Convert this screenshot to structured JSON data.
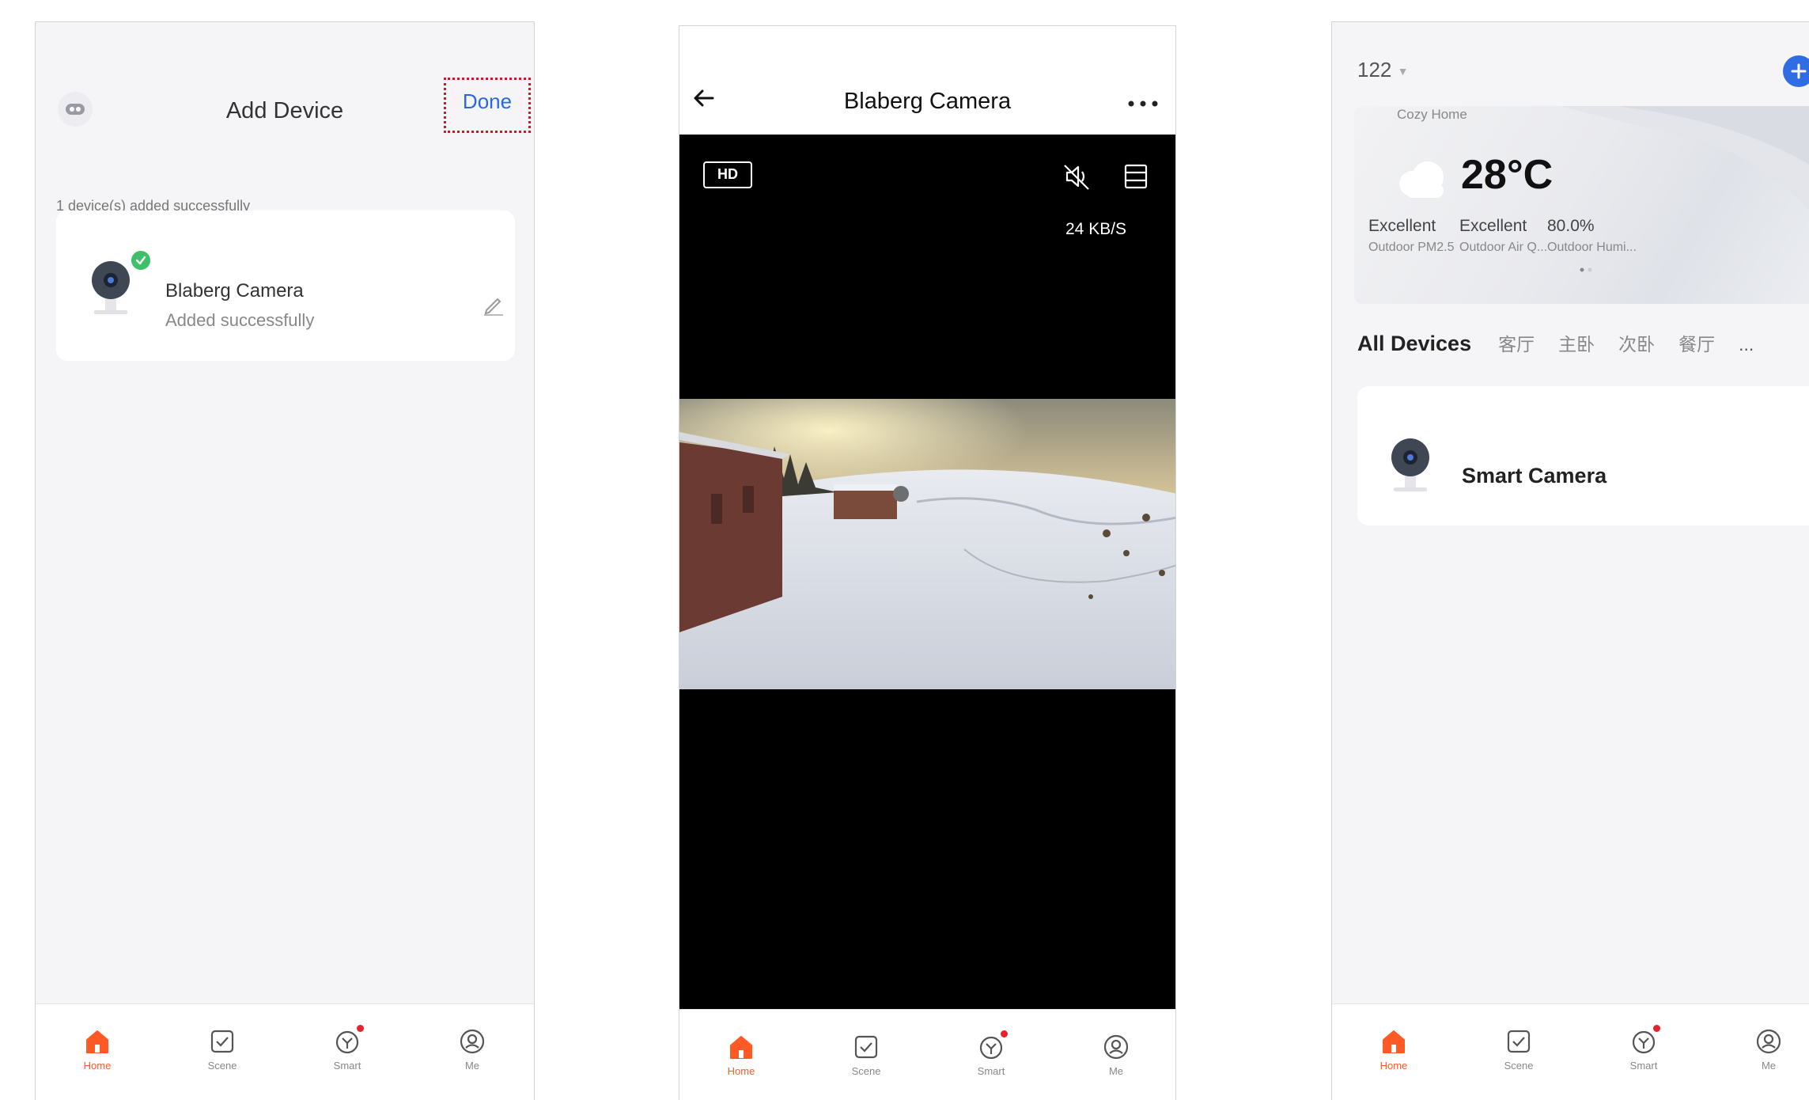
{
  "screen1": {
    "title": "Add Device",
    "done_label": "Done",
    "status": "1 device(s) added successfully",
    "device": {
      "name": "Blaberg Camera",
      "status": "Added successfully"
    }
  },
  "screen2": {
    "title": "Blaberg Camera",
    "hd_label": "HD",
    "bitrate": "24 KB/S"
  },
  "screen3": {
    "home_name": "122",
    "home_subtitle": "Cozy Home",
    "temperature": "28°C",
    "weather_stats": [
      {
        "value": "Excellent",
        "label": "Outdoor PM2.5"
      },
      {
        "value": "Excellent",
        "label": "Outdoor Air Q..."
      },
      {
        "value": "80.0%",
        "label": "Outdoor Humi..."
      }
    ],
    "room_tabs": [
      "All Devices",
      "客厅",
      "主卧",
      "次卧",
      "餐厅"
    ],
    "more_label": "...",
    "device": {
      "name": "Smart Camera"
    }
  },
  "tabbar": {
    "items": [
      {
        "label": "Home",
        "icon": "home-icon"
      },
      {
        "label": "Scene",
        "icon": "scene-icon"
      },
      {
        "label": "Smart",
        "icon": "smart-icon"
      },
      {
        "label": "Me",
        "icon": "me-icon"
      }
    ]
  },
  "colors": {
    "accent": "#ff5a26",
    "link": "#2a67e6",
    "success": "#3ec06a",
    "highlight": "#d8142a",
    "add_button": "#2f6de5"
  }
}
